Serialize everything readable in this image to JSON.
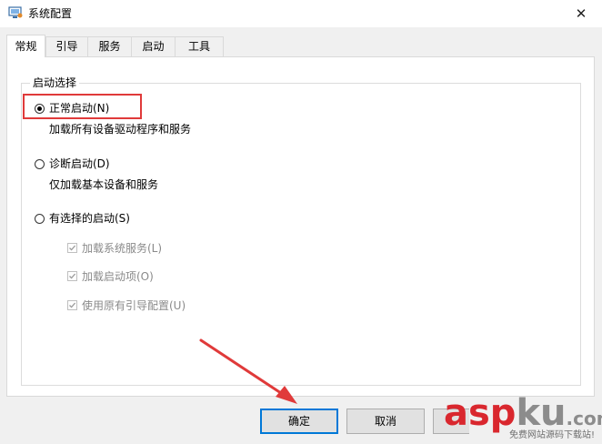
{
  "window": {
    "title": "系统配置",
    "close_glyph": "✕"
  },
  "tabs": [
    {
      "label": "常规",
      "active": true
    },
    {
      "label": "引导",
      "active": false
    },
    {
      "label": "服务",
      "active": false
    },
    {
      "label": "启动",
      "active": false
    },
    {
      "label": "工具",
      "active": false
    }
  ],
  "startup_selection": {
    "legend": "启动选择",
    "options": [
      {
        "label": "正常启动(N)",
        "selected": true,
        "description": "加载所有设备驱动程序和服务"
      },
      {
        "label": "诊断启动(D)",
        "selected": false,
        "description": "仅加载基本设备和服务"
      },
      {
        "label": "有选择的启动(S)",
        "selected": false
      }
    ],
    "selective_items": [
      {
        "label": "加载系统服务(L)",
        "checked": true,
        "enabled": false
      },
      {
        "label": "加载启动项(O)",
        "checked": true,
        "enabled": false
      },
      {
        "label": "使用原有引导配置(U)",
        "checked": true,
        "enabled": false
      }
    ]
  },
  "buttons": {
    "ok": "确定",
    "cancel": "取消"
  },
  "watermark": {
    "brand_asp": "asp",
    "brand_ku": "ku",
    "brand_com": ".com",
    "tagline": "免费网站源码下载站!"
  },
  "colors": {
    "annotation_red": "#e03a3a",
    "focus_blue": "#0078d7",
    "watermark_red": "#d9272e",
    "watermark_gray": "#8c8c8c"
  }
}
